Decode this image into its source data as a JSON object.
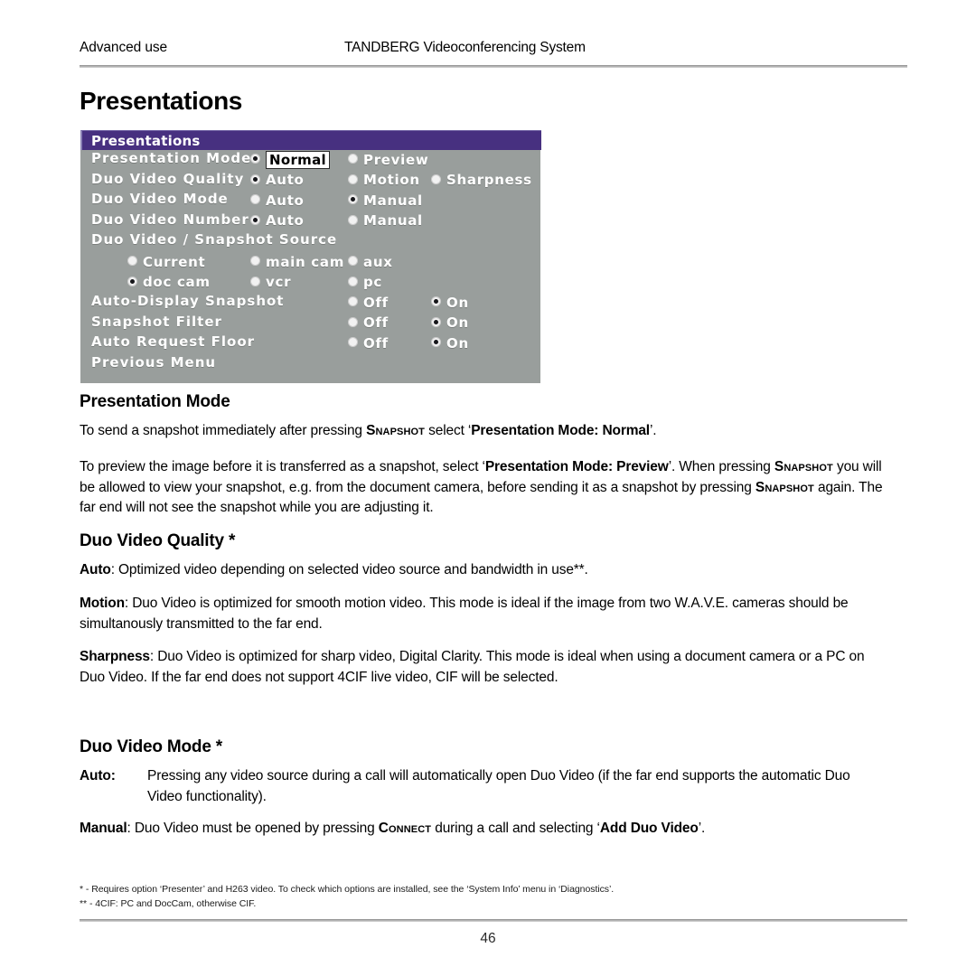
{
  "header": {
    "left": "Advanced use",
    "center": "TANDBERG Videoconferencing System"
  },
  "page_title": "Presentations",
  "osd_menu": {
    "title": "Presentations",
    "colors": {
      "titlebar": "#473080",
      "background": "#999E9C",
      "label_text": "#FFFFFF",
      "highlight_bg": "#FFFFFF",
      "highlight_text": "#000000"
    },
    "rows": [
      {
        "label": "Presentation Mode",
        "options": [
          {
            "text": "Normal",
            "selected": true,
            "highlighted": true
          },
          {
            "text": "Preview",
            "selected": false,
            "highlighted": false
          }
        ]
      },
      {
        "label": "Duo Video Quality",
        "options": [
          {
            "text": "Auto",
            "selected": true,
            "highlighted": false
          },
          {
            "text": "Motion",
            "selected": false,
            "highlighted": false
          },
          {
            "text": "Sharpness",
            "selected": false,
            "highlighted": false
          }
        ]
      },
      {
        "label": "Duo Video Mode",
        "options": [
          {
            "text": "Auto",
            "selected": false,
            "highlighted": false
          },
          {
            "text": "Manual",
            "selected": true,
            "highlighted": false
          }
        ]
      },
      {
        "label": "Duo Video Number",
        "options": [
          {
            "text": "Auto",
            "selected": true,
            "highlighted": false
          },
          {
            "text": "Manual",
            "selected": false,
            "highlighted": false
          }
        ]
      },
      {
        "label": "Duo Video / Snapshot Source",
        "options": []
      },
      {
        "label": "",
        "indent": true,
        "options": [
          {
            "text": "Current",
            "selected": false,
            "highlighted": false
          },
          {
            "text": "main cam",
            "selected": false,
            "highlighted": false
          },
          {
            "text": "aux",
            "selected": false,
            "highlighted": false
          }
        ]
      },
      {
        "label": "",
        "indent": true,
        "options": [
          {
            "text": "doc cam",
            "selected": true,
            "highlighted": false
          },
          {
            "text": "vcr",
            "selected": false,
            "highlighted": false
          },
          {
            "text": "pc",
            "selected": false,
            "highlighted": false
          }
        ]
      },
      {
        "label": "Auto-Display Snapshot",
        "options": [
          {
            "text": "Off",
            "selected": false,
            "highlighted": false
          },
          {
            "text": "On",
            "selected": true,
            "highlighted": false
          }
        ]
      },
      {
        "label": "Snapshot Filter",
        "options": [
          {
            "text": "Off",
            "selected": false,
            "highlighted": false
          },
          {
            "text": "On",
            "selected": true,
            "highlighted": false
          }
        ]
      },
      {
        "label": "Auto Request Floor",
        "options": [
          {
            "text": "Off",
            "selected": false,
            "highlighted": false
          },
          {
            "text": "On",
            "selected": true,
            "highlighted": false
          }
        ]
      },
      {
        "label": "Previous Menu",
        "options": []
      }
    ]
  },
  "sections": {
    "presentation_mode": {
      "heading": "Presentation Mode",
      "para1_a": "To send a snapshot immediately after pressing ",
      "para1_sc": "Snapshot",
      "para1_b": " select ‘",
      "para1_bold": "Presentation Mode: Normal",
      "para1_c": "’.",
      "para2_a": "To preview the image before it is transferred as a snapshot, select ‘",
      "para2_bold1": "Presentation Mode: Preview",
      "para2_b": "’. When pressing ",
      "para2_sc1": "Snapshot",
      "para2_c": " you will be allowed to view your snapshot, e.g. from the document camera, before sending it as a snapshot by pressing ",
      "para2_sc2": "Snapshot",
      "para2_d": " again. The far end will not see the snapshot while you are adjusting it."
    },
    "duo_video_quality": {
      "heading": "Duo Video Quality *",
      "auto_term": "Auto",
      "auto_text": ": Optimized video depending on selected video source and bandwidth in use**.",
      "motion_term": "Motion",
      "motion_text": ": Duo Video is optimized for smooth motion video. This mode is ideal if the image from two W.A.V.E. cameras should be simultanously transmitted to the far end.",
      "sharpness_term": "Sharpness",
      "sharpness_text": ": Duo Video is optimized for sharp video, Digital Clarity. This mode is ideal when using a document camera or a PC on Duo Video. If the far end does not support 4CIF live video, CIF will be selected."
    },
    "duo_video_mode": {
      "heading": "Duo Video Mode *",
      "auto_term": "Auto:",
      "auto_text": "Pressing any video source during a call will automatically open Duo Video (if the far end supports the automatic Duo Video functionality).",
      "manual_term": "Manual",
      "manual_a": ": Duo Video must be opened by pressing ",
      "manual_sc": "Connect",
      "manual_b": " during a call and selecting ‘",
      "manual_bold": "Add Duo Video",
      "manual_c": "’."
    }
  },
  "footnotes": [
    "* - Requires option ‘Presenter’ and H263 video. To check which options are installed, see the ‘System Info’ menu in ‘Diagnostics’.",
    "** - 4CIF: PC and DocCam, otherwise CIF."
  ],
  "page_number": "46"
}
